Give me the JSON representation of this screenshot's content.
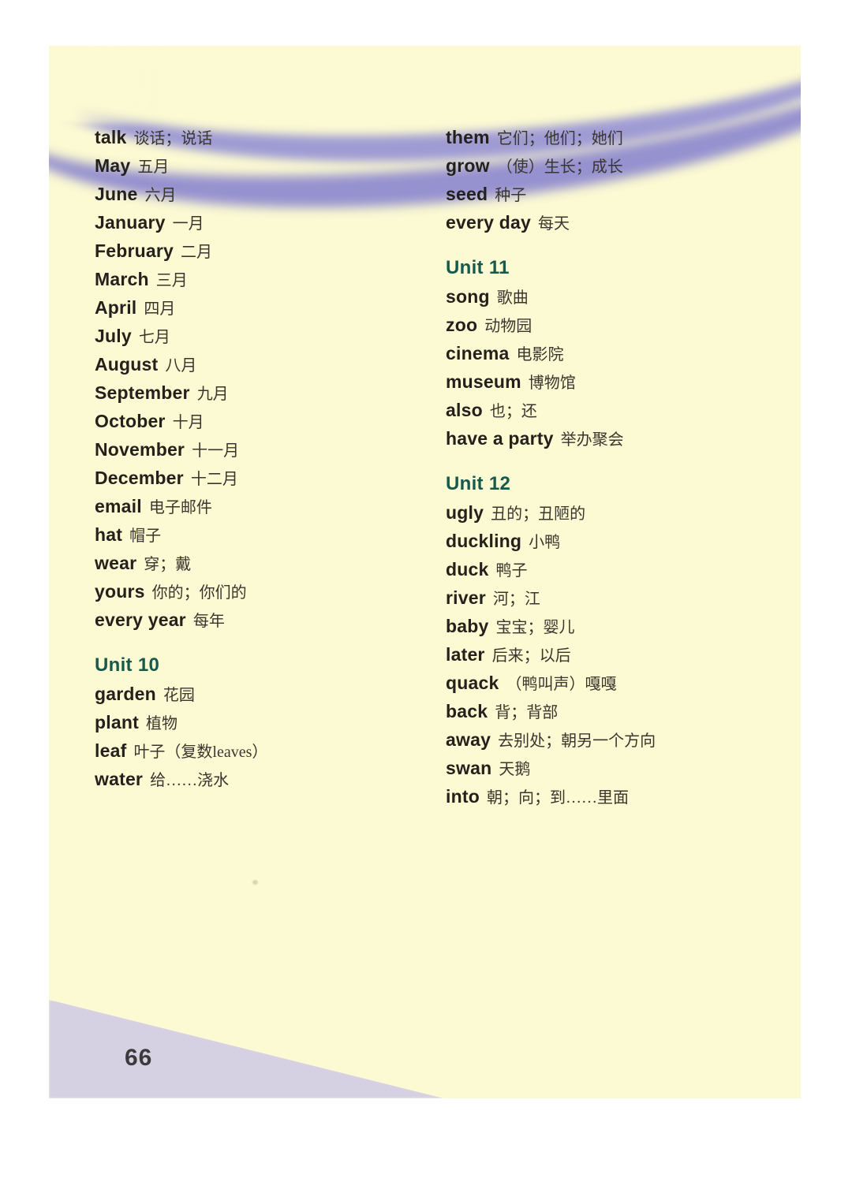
{
  "page": {
    "number": "66",
    "paper_color": "#fcfad2",
    "ribbon_color": "#9a96d4",
    "corner_wedge_color": "#d3cde4",
    "unit_heading_color": "#17594d"
  },
  "columns": {
    "left": [
      {
        "kind": "entry",
        "word": "talk",
        "gloss": "谈话；说话"
      },
      {
        "kind": "entry",
        "word": "May",
        "gloss": "五月"
      },
      {
        "kind": "entry",
        "word": "June",
        "gloss": "六月"
      },
      {
        "kind": "entry",
        "word": "January",
        "gloss": "一月"
      },
      {
        "kind": "entry",
        "word": "February",
        "gloss": "二月"
      },
      {
        "kind": "entry",
        "word": "March",
        "gloss": "三月"
      },
      {
        "kind": "entry",
        "word": "April",
        "gloss": "四月"
      },
      {
        "kind": "entry",
        "word": "July",
        "gloss": "七月"
      },
      {
        "kind": "entry",
        "word": "August",
        "gloss": "八月"
      },
      {
        "kind": "entry",
        "word": "September",
        "gloss": "九月"
      },
      {
        "kind": "entry",
        "word": "October",
        "gloss": "十月"
      },
      {
        "kind": "entry",
        "word": "November",
        "gloss": "十一月"
      },
      {
        "kind": "entry",
        "word": "December",
        "gloss": "十二月"
      },
      {
        "kind": "entry",
        "word": "email",
        "gloss": "电子邮件"
      },
      {
        "kind": "entry",
        "word": "hat",
        "gloss": "帽子"
      },
      {
        "kind": "entry",
        "word": "wear",
        "gloss": "穿；戴"
      },
      {
        "kind": "entry",
        "word": "yours",
        "gloss": "你的；你们的"
      },
      {
        "kind": "entry",
        "word": "every year",
        "gloss": "每年"
      },
      {
        "kind": "heading",
        "label": "Unit 10"
      },
      {
        "kind": "entry",
        "word": "garden",
        "gloss": "花园"
      },
      {
        "kind": "entry",
        "word": "plant",
        "gloss": "植物"
      },
      {
        "kind": "entry",
        "word": "leaf",
        "gloss": "叶子（复数leaves）"
      },
      {
        "kind": "entry",
        "word": "water",
        "gloss": "给……浇水"
      }
    ],
    "right": [
      {
        "kind": "entry",
        "word": "them",
        "gloss": "它们；他们；她们"
      },
      {
        "kind": "entry",
        "word": "grow",
        "gloss": "（使）生长；成长"
      },
      {
        "kind": "entry",
        "word": "seed",
        "gloss": "种子"
      },
      {
        "kind": "entry",
        "word": "every day",
        "gloss": "每天"
      },
      {
        "kind": "heading",
        "label": "Unit 11"
      },
      {
        "kind": "entry",
        "word": "song",
        "gloss": "歌曲"
      },
      {
        "kind": "entry",
        "word": "zoo",
        "gloss": "动物园"
      },
      {
        "kind": "entry",
        "word": "cinema",
        "gloss": "电影院"
      },
      {
        "kind": "entry",
        "word": "museum",
        "gloss": "博物馆"
      },
      {
        "kind": "entry",
        "word": "also",
        "gloss": "也；还"
      },
      {
        "kind": "entry",
        "word": "have a party",
        "gloss": "举办聚会"
      },
      {
        "kind": "heading",
        "label": "Unit 12"
      },
      {
        "kind": "entry",
        "word": "ugly",
        "gloss": "丑的；丑陋的"
      },
      {
        "kind": "entry",
        "word": "duckling",
        "gloss": "小鸭"
      },
      {
        "kind": "entry",
        "word": "duck",
        "gloss": "鸭子"
      },
      {
        "kind": "entry",
        "word": "river",
        "gloss": "河；江"
      },
      {
        "kind": "entry",
        "word": "baby",
        "gloss": "宝宝；婴儿"
      },
      {
        "kind": "entry",
        "word": "later",
        "gloss": "后来；以后"
      },
      {
        "kind": "entry",
        "word": "quack",
        "gloss": "（鸭叫声）嘎嘎"
      },
      {
        "kind": "entry",
        "word": "back",
        "gloss": "背；背部"
      },
      {
        "kind": "entry",
        "word": "away",
        "gloss": "去别处；朝另一个方向"
      },
      {
        "kind": "entry",
        "word": "swan",
        "gloss": "天鹅"
      },
      {
        "kind": "entry",
        "word": "into",
        "gloss": "朝；向；到……里面"
      }
    ]
  }
}
